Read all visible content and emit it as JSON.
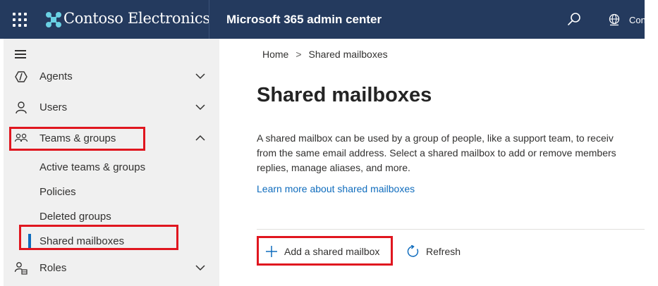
{
  "header": {
    "brand": "Contoso Electronics",
    "app_title": "Microsoft 365 admin center",
    "tenant_label": "Con",
    "icons": [
      "app-launcher-icon",
      "contoso-logo-icon",
      "search-icon",
      "globe-icon"
    ],
    "background_color": "#243a5e"
  },
  "sidebar": {
    "items": [
      {
        "label": "Agents",
        "icon": "agents-icon",
        "expanded": false
      },
      {
        "label": "Users",
        "icon": "user-icon",
        "expanded": false
      },
      {
        "label": "Teams & groups",
        "icon": "teams-groups-icon",
        "expanded": true
      },
      {
        "label": "Roles",
        "icon": "roles-icon",
        "expanded": false
      }
    ],
    "subitems": [
      {
        "label": "Active teams & groups",
        "selected": false
      },
      {
        "label": "Policies",
        "selected": false
      },
      {
        "label": "Deleted groups",
        "selected": false
      },
      {
        "label": "Shared mailboxes",
        "selected": true
      }
    ]
  },
  "breadcrumb": {
    "home": "Home",
    "separator": ">",
    "current": "Shared mailboxes"
  },
  "main": {
    "title": "Shared mailboxes",
    "description_lines": [
      "A shared mailbox can be used by a group of people, like a support team, to receiv",
      "from the same email address. Select a shared mailbox to add or remove members",
      "replies, manage aliases, and more."
    ],
    "learn_more": "Learn more about shared mailboxes",
    "commands": {
      "add": "Add a shared mailbox",
      "refresh": "Refresh"
    }
  },
  "colors": {
    "accent": "#0f6cbd",
    "highlight": "#e0161f",
    "sidebar_bg": "#f0f0f0"
  }
}
